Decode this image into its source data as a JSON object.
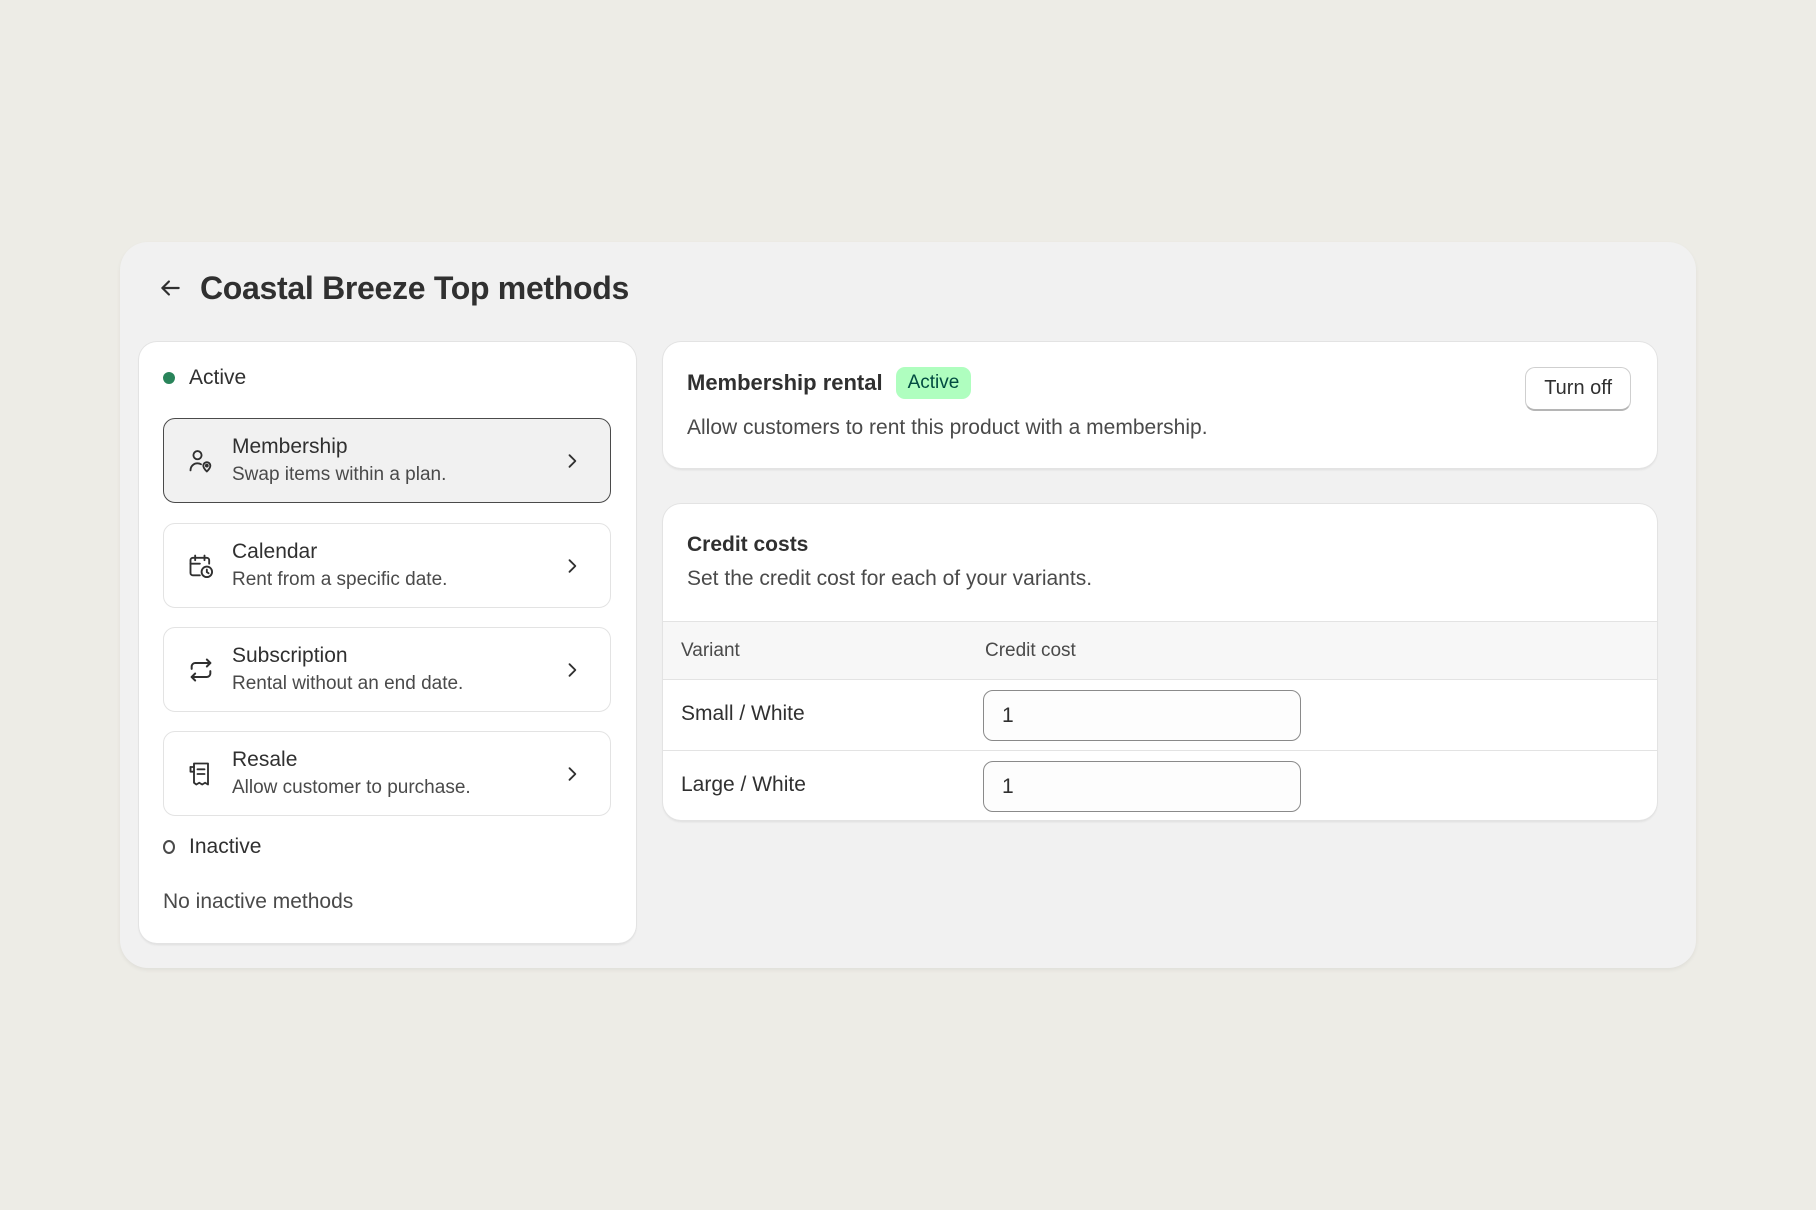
{
  "header": {
    "title": "Coastal Breeze Top methods",
    "back_icon": "arrow-left-icon"
  },
  "methods": {
    "active_label": "Active",
    "inactive_label": "Inactive",
    "empty_inactive": "No inactive methods",
    "items": [
      {
        "title": "Membership",
        "subtitle": "Swap items within a plan.",
        "icon": "membership-icon",
        "selected": true
      },
      {
        "title": "Calendar",
        "subtitle": "Rent from a specific date.",
        "icon": "calendar-clock-icon",
        "selected": false
      },
      {
        "title": "Subscription",
        "subtitle": "Rental without an end date.",
        "icon": "repeat-icon",
        "selected": false
      },
      {
        "title": "Resale",
        "subtitle": "Allow customer to purchase.",
        "icon": "receipt-icon",
        "selected": false
      }
    ]
  },
  "rental": {
    "title": "Membership rental",
    "badge": "Active",
    "description": "Allow customers to rent this product with a membership.",
    "turn_off_label": "Turn off"
  },
  "credit": {
    "title": "Credit costs",
    "description": "Set the credit cost for each of your variants.",
    "columns": [
      "Variant",
      "Credit cost"
    ],
    "rows": [
      {
        "variant": "Small / White",
        "cost": "1"
      },
      {
        "variant": "Large / White",
        "cost": "1"
      }
    ]
  },
  "colors": {
    "active_dot": "#29845a",
    "badge_bg": "#affebf",
    "badge_text": "#014b40",
    "page_bg": "#edece6"
  }
}
